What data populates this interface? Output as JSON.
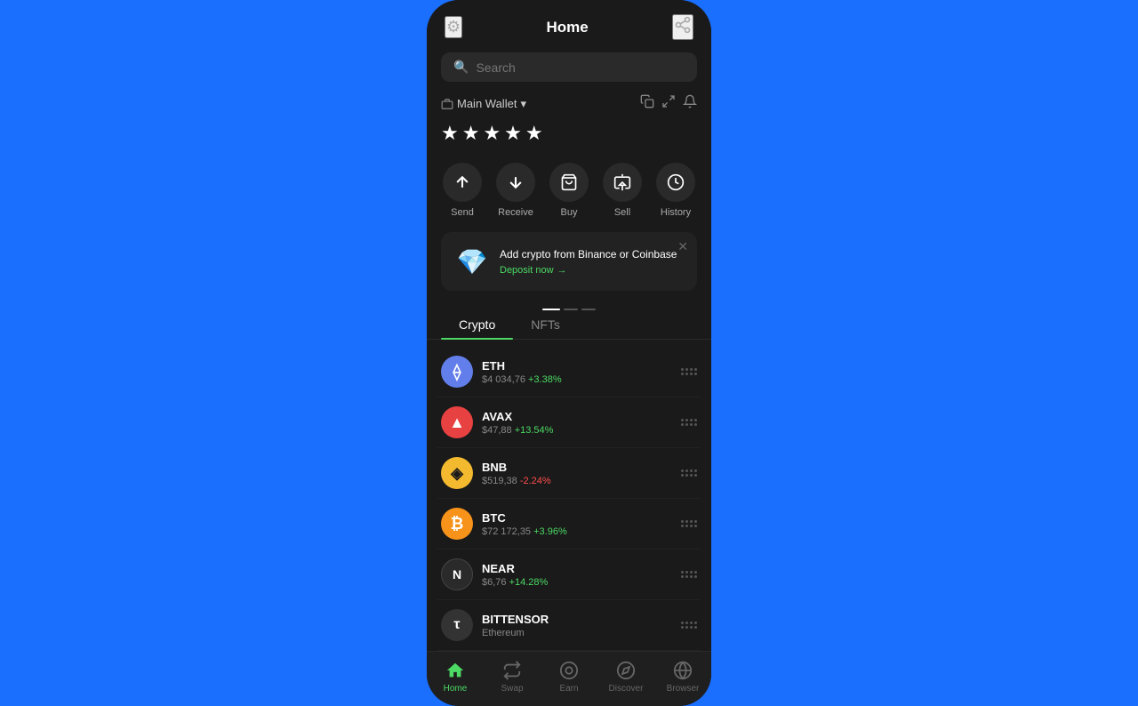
{
  "header": {
    "title": "Home",
    "settings_icon": "⚙",
    "connect_icon": "🔗"
  },
  "search": {
    "placeholder": "Search"
  },
  "wallet": {
    "name": "Main Wallet",
    "dropdown_icon": "▾",
    "balance_hidden": "★★★★★",
    "copy_icon": "⧉",
    "expand_icon": "⛶",
    "notify_icon": "🔔"
  },
  "quick_actions": [
    {
      "id": "send",
      "label": "Send",
      "icon": "↑"
    },
    {
      "id": "receive",
      "label": "Receive",
      "icon": "↓"
    },
    {
      "id": "buy",
      "label": "Buy",
      "icon": "🏪"
    },
    {
      "id": "sell",
      "label": "Sell",
      "icon": "🏛"
    },
    {
      "id": "history",
      "label": "History",
      "icon": "🕐"
    }
  ],
  "promo": {
    "title": "Add crypto from Binance or Coinbase",
    "link_label": "Deposit now",
    "link_arrow": "→",
    "emoji": "💎",
    "dots": [
      {
        "active": true,
        "color": "#fff"
      },
      {
        "active": false,
        "color": "#444"
      },
      {
        "active": false,
        "color": "#444"
      }
    ]
  },
  "tabs": [
    {
      "id": "crypto",
      "label": "Crypto",
      "active": true
    },
    {
      "id": "nfts",
      "label": "NFTs",
      "active": false
    }
  ],
  "crypto_list": [
    {
      "symbol": "ETH",
      "name": "ETH",
      "price": "$4 034,76",
      "change": "+3.38%",
      "positive": true,
      "icon_text": "⟠",
      "icon_class": "eth-icon"
    },
    {
      "symbol": "AVAX",
      "name": "AVAX",
      "price": "$47,88",
      "change": "+13.54%",
      "positive": true,
      "icon_text": "▲",
      "icon_class": "avax-icon"
    },
    {
      "symbol": "BNB",
      "name": "BNB",
      "price": "$519,38",
      "change": "-2.24%",
      "positive": false,
      "icon_text": "◈",
      "icon_class": "bnb-icon"
    },
    {
      "symbol": "BTC",
      "name": "BTC",
      "price": "$72 172,35",
      "change": "+3.96%",
      "positive": true,
      "icon_text": "₿",
      "icon_class": "btc-icon"
    },
    {
      "symbol": "NEAR",
      "name": "NEAR",
      "price": "$6,76",
      "change": "+14.28%",
      "positive": true,
      "icon_text": "Ν",
      "icon_class": "near-icon"
    },
    {
      "symbol": "BITTENSOR",
      "name": "BITTENSOR",
      "price": "Ethereum",
      "change": "",
      "positive": true,
      "icon_text": "τ",
      "icon_class": "bittensor-icon"
    }
  ],
  "bottom_nav": [
    {
      "id": "home",
      "label": "Home",
      "icon": "⌂",
      "active": true
    },
    {
      "id": "swap",
      "label": "Swap",
      "icon": "⇄",
      "active": false
    },
    {
      "id": "earn",
      "label": "Earn",
      "icon": "◎",
      "active": false
    },
    {
      "id": "discover",
      "label": "Discover",
      "icon": "💡",
      "active": false
    },
    {
      "id": "browser",
      "label": "Browser",
      "icon": "🌐",
      "active": false
    }
  ]
}
